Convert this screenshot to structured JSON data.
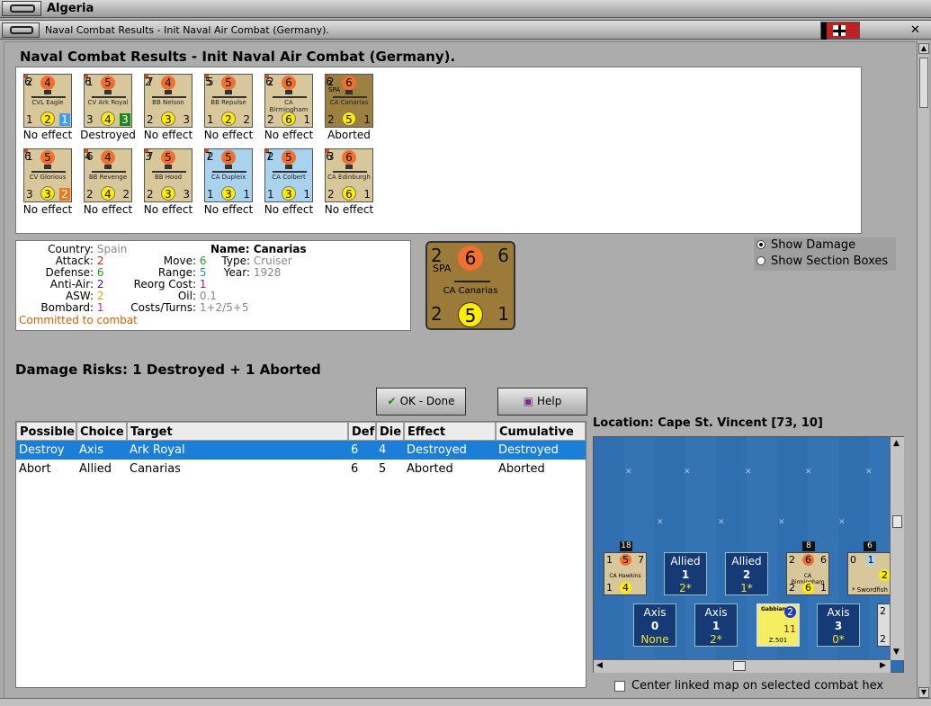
{
  "window": {
    "title": "Algeria",
    "subtitle": "Naval Combat Results - Init Naval Air Combat (Germany)."
  },
  "dialog_title": "Naval Combat Results - Init Naval Air Combat (Germany).",
  "counters": [
    {
      "tl": "2",
      "tc": "4",
      "tr": "6",
      "name": "CVL Eagle",
      "bl": "1",
      "bc": "2",
      "br": "1",
      "sq": "blue",
      "bg": "tan",
      "result": "No effect"
    },
    {
      "tl": "1",
      "tc": "5",
      "tr": "6",
      "name": "CV Ark Royal",
      "bl": "3",
      "bc": "4",
      "br": "3",
      "sq": "green",
      "bg": "tan",
      "result": "Destroyed"
    },
    {
      "tl": "7",
      "tc": "4",
      "tr": "2",
      "name": "BB Nelson",
      "bl": "2",
      "bc": "3",
      "br": "3",
      "sq": "",
      "bg": "tan",
      "result": "No effect"
    },
    {
      "tl": "5",
      "tc": "5",
      "tr": "5",
      "name": "BB Repulse",
      "bl": "1",
      "bc": "2",
      "br": "2",
      "sq": "",
      "bg": "tan",
      "result": "No effect"
    },
    {
      "tl": "2",
      "tc": "6",
      "tr": "6",
      "name": "CA Birmingham",
      "bl": "2",
      "bc": "6",
      "br": "1",
      "sq": "",
      "bg": "tan",
      "result": "No effect"
    },
    {
      "tl": "2",
      "tc": "6",
      "tr": "6",
      "name": "CA Canarias",
      "bl": "2",
      "bc": "5",
      "br": "1",
      "sq": "",
      "bg": "brn",
      "result": "Aborted",
      "nation": "SPA"
    },
    {
      "tl": "1",
      "tc": "5",
      "tr": "6",
      "name": "CV Glorious",
      "bl": "3",
      "bc": "3",
      "br": "2",
      "sq": "orange",
      "bg": "tan",
      "result": "No effect"
    },
    {
      "tl": "6",
      "tc": "4",
      "tr": "4",
      "name": "BB Revenge",
      "bl": "2",
      "bc": "4",
      "br": "2",
      "sq": "",
      "bg": "tan",
      "result": "No effect"
    },
    {
      "tl": "7",
      "tc": "5",
      "tr": "3",
      "name": "BB Hood",
      "bl": "2",
      "bc": "3",
      "br": "3",
      "sq": "",
      "bg": "tan",
      "result": "No effect"
    },
    {
      "tl": "2",
      "tc": "5",
      "tr": "7",
      "name": "CA Dupleix",
      "bl": "1",
      "bc": "3",
      "br": "1",
      "sq": "",
      "bg": "blu",
      "result": "No effect"
    },
    {
      "tl": "2",
      "tc": "5",
      "tr": "7",
      "name": "CA Colbert",
      "bl": "1",
      "bc": "3",
      "br": "1",
      "sq": "",
      "bg": "blu",
      "result": "No effect"
    },
    {
      "tl": "3",
      "tc": "6",
      "tr": "6",
      "name": "CA Edinburgh",
      "bl": "2",
      "bc": "6",
      "br": "1",
      "sq": "",
      "bg": "tan",
      "result": "No effect"
    }
  ],
  "info": {
    "country_label": "Country:",
    "country": "Spain",
    "attack_label": "Attack:",
    "attack": "2",
    "defense_label": "Defense:",
    "defense": "6",
    "antiair_label": "Anti-Air:",
    "antiair": "2",
    "asw_label": "ASW:",
    "asw": "2",
    "bombard_label": "Bombard:",
    "bombard": "1",
    "committed": "Committed to combat",
    "move_label": "Move:",
    "move": "6",
    "range_label": "Range:",
    "range": "5",
    "reorg_label": "Reorg Cost:",
    "reorg": "1",
    "oil_label": "Oil:",
    "oil": "0.1",
    "costs_label": "Costs/Turns:",
    "costs": "1+2/5+5",
    "name_label": "Name:",
    "name": "Canarias",
    "type_label": "Type:",
    "type": "Cruiser",
    "year_label": "Year:",
    "year": "1928"
  },
  "big_counter": {
    "tl": "2",
    "tc": "6",
    "tr": "6",
    "nation": "SPA",
    "name": "CA Canarias",
    "bl": "2",
    "bc": "5",
    "br": "1"
  },
  "options": {
    "show_damage": "Show Damage",
    "show_sections": "Show Section Boxes"
  },
  "damage_risks": "Damage Risks: 1 Destroyed + 1 Aborted",
  "buttons": {
    "ok": "OK - Done",
    "help": "Help"
  },
  "table": {
    "headers": [
      "Possible",
      "Choice",
      "Target",
      "Def",
      "Die",
      "Effect",
      "Cumulative"
    ],
    "rows": [
      [
        "Destroy",
        "Axis",
        "Ark Royal",
        "6",
        "4",
        "Destroyed",
        "Destroyed"
      ],
      [
        "Abort",
        "Allied",
        "Canarias",
        "6",
        "5",
        "Aborted",
        "Aborted"
      ]
    ]
  },
  "location": "Location:  Cape St. Vincent [73, 10]",
  "map": {
    "allied_boxes": [
      {
        "label": "Allied",
        "count": "1",
        "val": "2*"
      },
      {
        "label": "Allied",
        "count": "2",
        "val": "1*"
      }
    ],
    "axis_boxes": [
      {
        "label": "Axis",
        "count": "0",
        "val": "None"
      },
      {
        "label": "Axis",
        "count": "1",
        "val": "2*"
      },
      {
        "label": "Axis",
        "count": "3",
        "val": "0*"
      }
    ],
    "stack_badges": [
      "18",
      "8",
      "6"
    ],
    "unit_names": [
      "CA Hawkins",
      "CA Birmingham",
      "* Swordfish",
      "Gabbiano",
      "Z.501"
    ]
  },
  "center_linked": "Center linked map on selected combat hex",
  "colors": {
    "attack": "#d02020",
    "defense": "#20a020",
    "antiair": "#2020c0",
    "asw": "#e0a000",
    "bombard": "#c020c0",
    "committed": "#d06000",
    "selected_row": "#1b7fd8"
  }
}
